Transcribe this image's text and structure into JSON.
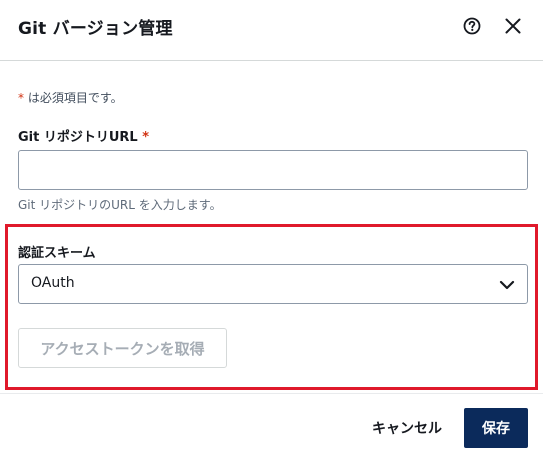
{
  "dialog": {
    "title": "Git バージョン管理",
    "help_icon": "help-circle-icon",
    "close_icon": "close-icon"
  },
  "form": {
    "required_star": "*",
    "required_note": " は必須項目です。",
    "repo_url": {
      "label": "Git リポジトリURL",
      "required_star": "*",
      "value": "",
      "help": "Git リポジトリのURL を入力します。"
    },
    "auth_scheme": {
      "label": "認証スキーム",
      "selected": "OAuth",
      "chevron_icon": "chevron-down-icon"
    },
    "token_button": "アクセストークンを取得"
  },
  "footer": {
    "cancel": "キャンセル",
    "save": "保存"
  },
  "colors": {
    "primary": "#0b2a5b",
    "required": "#d13212",
    "highlight": "#e0192b"
  }
}
